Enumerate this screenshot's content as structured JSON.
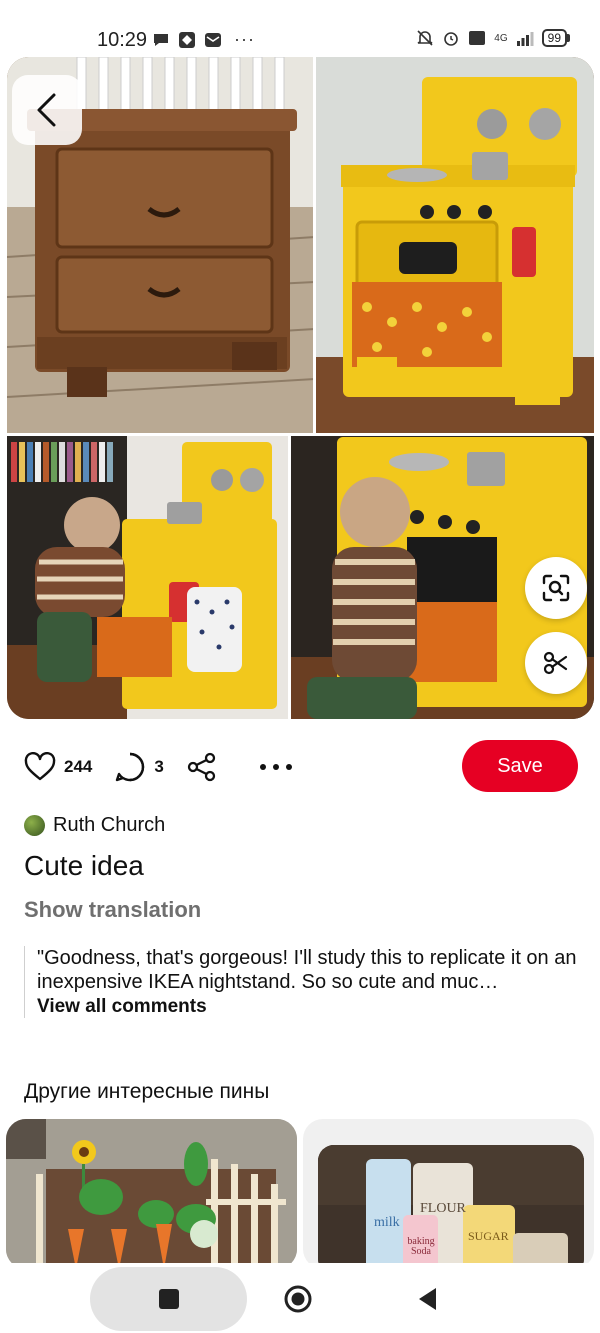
{
  "status_bar": {
    "time": "10:29",
    "battery": "99",
    "network": "4G",
    "overflow": "···"
  },
  "pin": {
    "image_icon": "photo-collage",
    "likes": "244",
    "comments": "3",
    "save_label": "Save",
    "author": "Ruth Church",
    "title": "Cute idea",
    "show_translation": "Show translation",
    "comment_text": "\"Goodness, that's gorgeous! I'll study this to replicate it on an inexpensive IKEA nightstand. So so cute and muc…",
    "view_all_comments": "View all comments"
  },
  "more_pins": {
    "heading": "Другие интересные пины",
    "pin2_words": [
      "milk",
      "FLOUR",
      "baking Soda",
      "SUGAR"
    ]
  },
  "colors": {
    "save_red": "#e60023",
    "muted_text": "#6f6f6f",
    "kitchen_yellow": "#f2c81c"
  },
  "icons": [
    "back-arrow-icon",
    "lens-scan-icon",
    "scissors-icon",
    "heart-icon",
    "comment-icon",
    "share-icon",
    "more-icon",
    "square-icon",
    "circle-icon",
    "triangle-back-icon"
  ]
}
